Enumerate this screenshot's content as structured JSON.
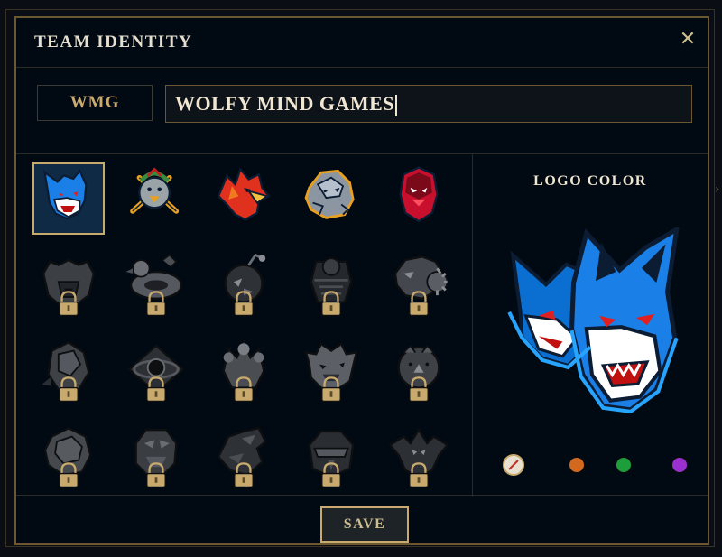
{
  "dialog": {
    "title": "TEAM IDENTITY",
    "close_icon": "close-icon",
    "tag": "WMG",
    "team_name": "WOLFY MIND GAMES"
  },
  "logos": [
    {
      "name": "wolves-logo",
      "locked": false,
      "selected": true
    },
    {
      "name": "baseball-bird-logo",
      "locked": false,
      "selected": false
    },
    {
      "name": "phoenix-logo",
      "locked": false,
      "selected": false
    },
    {
      "name": "rock-golem-logo",
      "locked": false,
      "selected": false
    },
    {
      "name": "red-ghost-logo",
      "locked": false,
      "selected": false
    },
    {
      "name": "bear-logo",
      "locked": true
    },
    {
      "name": "duck-floatie-logo",
      "locked": true
    },
    {
      "name": "bomb-bird-logo",
      "locked": true
    },
    {
      "name": "masked-figure-logo",
      "locked": true
    },
    {
      "name": "spiky-beast-logo",
      "locked": true
    },
    {
      "name": "shell-creature-logo",
      "locked": true
    },
    {
      "name": "black-hole-logo",
      "locked": true
    },
    {
      "name": "claw-logo",
      "locked": true
    },
    {
      "name": "fluffy-monster-logo",
      "locked": true
    },
    {
      "name": "rhino-logo",
      "locked": true
    },
    {
      "name": "stone-orb-logo",
      "locked": true
    },
    {
      "name": "rock-monster-logo",
      "locked": true
    },
    {
      "name": "dragon-logo",
      "locked": true
    },
    {
      "name": "helmet-logo",
      "locked": true
    },
    {
      "name": "bat-logo",
      "locked": true
    }
  ],
  "lock_icon": "lock-icon",
  "logo_color": {
    "title": "LOGO COLOR",
    "preview": "wolves-logo",
    "swatches": [
      {
        "name": "default-swatch",
        "color": "#e8e0d0",
        "selected": true
      },
      {
        "name": "orange-swatch",
        "color": "#d2691e",
        "selected": false
      },
      {
        "name": "green-swatch",
        "color": "#1e9e3a",
        "selected": false
      },
      {
        "name": "purple-swatch",
        "color": "#9b30d0",
        "selected": false
      },
      {
        "name": "pink-swatch",
        "color": "#e060b0",
        "selected": false
      }
    ]
  },
  "footer": {
    "save_label": "SAVE"
  },
  "colors": {
    "gold": "#c8aa6e",
    "gold_dark": "#6b5730",
    "background": "#010a13",
    "text_light": "#f0e6d2"
  }
}
